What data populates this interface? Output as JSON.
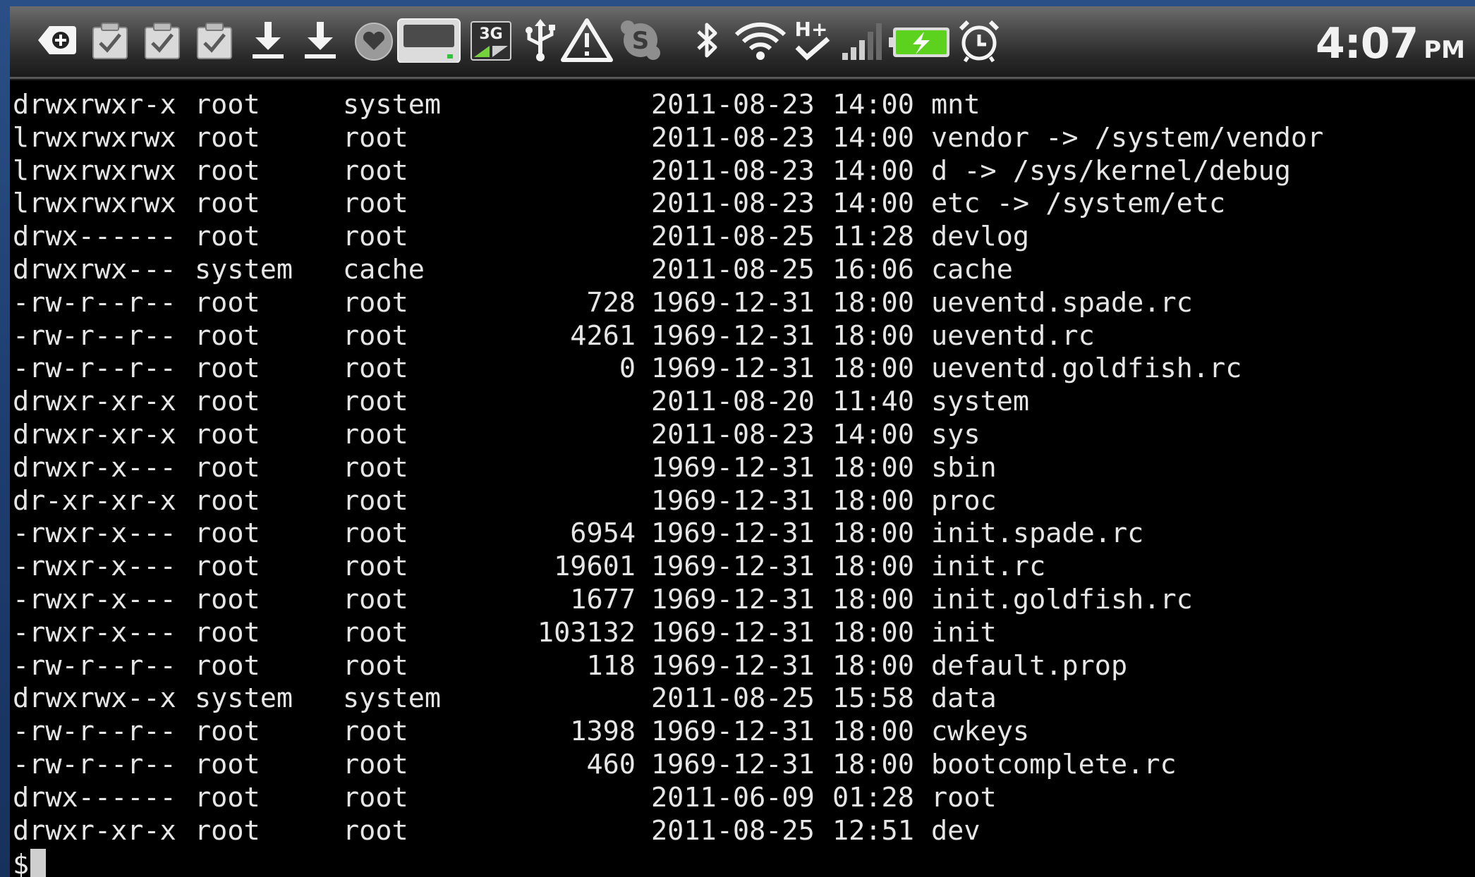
{
  "status_bar": {
    "icons": [
      "add-notification-icon",
      "task-check-icon",
      "task-check-icon",
      "task-check-icon",
      "download-icon",
      "download-icon",
      "heart-badge-icon",
      "sd-card-icon",
      "3g-data-icon",
      "usb-icon",
      "warning-icon",
      "skype-icon",
      "bluetooth-icon",
      "wifi-icon",
      "h-plus-icon",
      "signal-bars-icon",
      "battery-charging-icon",
      "alarm-clock-icon"
    ],
    "data_label": "3G",
    "network_label": "H+",
    "skype_letter": "S",
    "clock_time": "4:07",
    "clock_ampm": "PM"
  },
  "terminal": {
    "rows": [
      {
        "perm": "drwxrwxr-x",
        "owner": "root",
        "group": "system",
        "size": "",
        "date": "2011-08-23",
        "time": "14:00",
        "name": "mnt"
      },
      {
        "perm": "lrwxrwxrwx",
        "owner": "root",
        "group": "root",
        "size": "",
        "date": "2011-08-23",
        "time": "14:00",
        "name": "vendor -> /system/vendor"
      },
      {
        "perm": "lrwxrwxrwx",
        "owner": "root",
        "group": "root",
        "size": "",
        "date": "2011-08-23",
        "time": "14:00",
        "name": "d -> /sys/kernel/debug"
      },
      {
        "perm": "lrwxrwxrwx",
        "owner": "root",
        "group": "root",
        "size": "",
        "date": "2011-08-23",
        "time": "14:00",
        "name": "etc -> /system/etc"
      },
      {
        "perm": "drwx------",
        "owner": "root",
        "group": "root",
        "size": "",
        "date": "2011-08-25",
        "time": "11:28",
        "name": "devlog"
      },
      {
        "perm": "drwxrwx---",
        "owner": "system",
        "group": "cache",
        "size": "",
        "date": "2011-08-25",
        "time": "16:06",
        "name": "cache"
      },
      {
        "perm": "-rw-r--r--",
        "owner": "root",
        "group": "root",
        "size": "728",
        "date": "1969-12-31",
        "time": "18:00",
        "name": "ueventd.spade.rc"
      },
      {
        "perm": "-rw-r--r--",
        "owner": "root",
        "group": "root",
        "size": "4261",
        "date": "1969-12-31",
        "time": "18:00",
        "name": "ueventd.rc"
      },
      {
        "perm": "-rw-r--r--",
        "owner": "root",
        "group": "root",
        "size": "0",
        "date": "1969-12-31",
        "time": "18:00",
        "name": "ueventd.goldfish.rc"
      },
      {
        "perm": "drwxr-xr-x",
        "owner": "root",
        "group": "root",
        "size": "",
        "date": "2011-08-20",
        "time": "11:40",
        "name": "system"
      },
      {
        "perm": "drwxr-xr-x",
        "owner": "root",
        "group": "root",
        "size": "",
        "date": "2011-08-23",
        "time": "14:00",
        "name": "sys"
      },
      {
        "perm": "drwxr-x---",
        "owner": "root",
        "group": "root",
        "size": "",
        "date": "1969-12-31",
        "time": "18:00",
        "name": "sbin"
      },
      {
        "perm": "dr-xr-xr-x",
        "owner": "root",
        "group": "root",
        "size": "",
        "date": "1969-12-31",
        "time": "18:00",
        "name": "proc"
      },
      {
        "perm": "-rwxr-x---",
        "owner": "root",
        "group": "root",
        "size": "6954",
        "date": "1969-12-31",
        "time": "18:00",
        "name": "init.spade.rc"
      },
      {
        "perm": "-rwxr-x---",
        "owner": "root",
        "group": "root",
        "size": "19601",
        "date": "1969-12-31",
        "time": "18:00",
        "name": "init.rc"
      },
      {
        "perm": "-rwxr-x---",
        "owner": "root",
        "group": "root",
        "size": "1677",
        "date": "1969-12-31",
        "time": "18:00",
        "name": "init.goldfish.rc"
      },
      {
        "perm": "-rwxr-x---",
        "owner": "root",
        "group": "root",
        "size": "103132",
        "date": "1969-12-31",
        "time": "18:00",
        "name": "init"
      },
      {
        "perm": "-rw-r--r--",
        "owner": "root",
        "group": "root",
        "size": "118",
        "date": "1969-12-31",
        "time": "18:00",
        "name": "default.prop"
      },
      {
        "perm": "drwxrwx--x",
        "owner": "system",
        "group": "system",
        "size": "",
        "date": "2011-08-25",
        "time": "15:58",
        "name": "data"
      },
      {
        "perm": "-rw-r--r--",
        "owner": "root",
        "group": "root",
        "size": "1398",
        "date": "1969-12-31",
        "time": "18:00",
        "name": "cwkeys"
      },
      {
        "perm": "-rw-r--r--",
        "owner": "root",
        "group": "root",
        "size": "460",
        "date": "1969-12-31",
        "time": "18:00",
        "name": "bootcomplete.rc"
      },
      {
        "perm": "drwx------",
        "owner": "root",
        "group": "root",
        "size": "",
        "date": "2011-06-09",
        "time": "01:28",
        "name": "root"
      },
      {
        "perm": "drwxr-xr-x",
        "owner": "root",
        "group": "root",
        "size": "",
        "date": "2011-08-25",
        "time": "12:51",
        "name": "dev"
      }
    ],
    "prompt": "$"
  },
  "colors": {
    "background_blue": "#1f3f72",
    "terminal_bg": "#000000",
    "terminal_fg": "#e6e6e6",
    "battery_green": "#5cd21f"
  }
}
